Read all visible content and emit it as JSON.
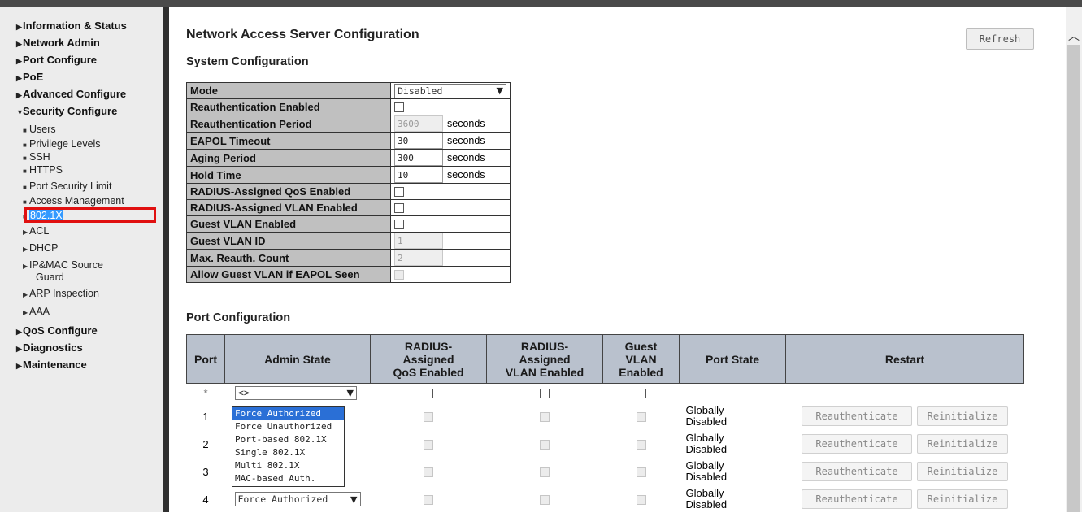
{
  "sidebar": {
    "items": [
      {
        "label": "Information & Status"
      },
      {
        "label": "Network Admin"
      },
      {
        "label": "Port Configure"
      },
      {
        "label": "PoE"
      },
      {
        "label": "Advanced Configure"
      },
      {
        "label": "Security Configure"
      }
    ],
    "security_sub": [
      {
        "label": "Users"
      },
      {
        "label": "Privilege Levels"
      },
      {
        "label": "SSH"
      },
      {
        "label": "HTTPS"
      },
      {
        "label": "Port Security Limit"
      },
      {
        "label": "Access Management"
      },
      {
        "label": "802.1X"
      },
      {
        "label": "ACL"
      },
      {
        "label": "DHCP"
      },
      {
        "label": "IP&MAC Source"
      },
      {
        "label": "Guard"
      },
      {
        "label": "ARP Inspection"
      },
      {
        "label": "AAA"
      }
    ],
    "bottom_items": [
      {
        "label": "QoS Configure"
      },
      {
        "label": "Diagnostics"
      },
      {
        "label": "Maintenance"
      }
    ],
    "highlight_color": "#e01010",
    "selected_color": "#3399ff"
  },
  "main": {
    "title": "Network Access Server Configuration",
    "refresh_label": "Refresh",
    "system_title": "System Configuration",
    "system_rows": {
      "mode": {
        "label": "Mode",
        "value": "Disabled"
      },
      "reauth_enabled": {
        "label": "Reauthentication Enabled"
      },
      "reauth_period": {
        "label": "Reauthentication Period",
        "value": "3600",
        "unit": "seconds"
      },
      "eapol_timeout": {
        "label": "EAPOL Timeout",
        "value": "30",
        "unit": "seconds"
      },
      "aging_period": {
        "label": "Aging Period",
        "value": "300",
        "unit": "seconds"
      },
      "hold_time": {
        "label": "Hold Time",
        "value": "10",
        "unit": "seconds"
      },
      "radius_qos": {
        "label": "RADIUS-Assigned QoS Enabled"
      },
      "radius_vlan": {
        "label": "RADIUS-Assigned VLAN Enabled"
      },
      "guest_vlan_enabled": {
        "label": "Guest VLAN Enabled"
      },
      "guest_vlan_id": {
        "label": "Guest VLAN ID",
        "value": "1"
      },
      "max_reauth": {
        "label": "Max. Reauth. Count",
        "value": "2"
      },
      "allow_guest": {
        "label": "Allow Guest VLAN if EAPOL Seen"
      }
    },
    "port_title": "Port Configuration",
    "port_headers": {
      "port": "Port",
      "admin_state": "Admin State",
      "radius_qos_1": "RADIUS-",
      "radius_qos_2": "Assigned",
      "radius_qos_3": "QoS Enabled",
      "radius_vlan_1": "RADIUS-",
      "radius_vlan_2": "Assigned",
      "radius_vlan_3": "VLAN Enabled",
      "guest_1": "Guest",
      "guest_2": "VLAN",
      "guest_3": "Enabled",
      "port_state": "Port State",
      "restart": "Restart"
    },
    "star_row": {
      "port": "*",
      "admin": "<>"
    },
    "ports": [
      {
        "port": "1",
        "state_1": "Globally",
        "state_2": "Disabled",
        "reauth": "Reauthenticate",
        "reinit": "Reinitialize"
      },
      {
        "port": "2",
        "state_1": "Globally",
        "state_2": "Disabled",
        "reauth": "Reauthenticate",
        "reinit": "Reinitialize"
      },
      {
        "port": "3",
        "state_1": "Globally",
        "state_2": "Disabled",
        "reauth": "Reauthenticate",
        "reinit": "Reinitialize"
      },
      {
        "port": "4",
        "admin": "Force Authorized",
        "state_1": "Globally",
        "state_2": "Disabled",
        "reauth": "Reauthenticate",
        "reinit": "Reinitialize"
      }
    ],
    "admin_dropdown": {
      "options": [
        "Force Authorized",
        "Force Unauthorized",
        "Port-based 802.1X",
        "Single 802.1X",
        "Multi 802.1X",
        "MAC-based Auth."
      ],
      "selected": "Force Authorized"
    },
    "header_color": "#b9c1cd",
    "label_color": "#c0c0c0"
  }
}
